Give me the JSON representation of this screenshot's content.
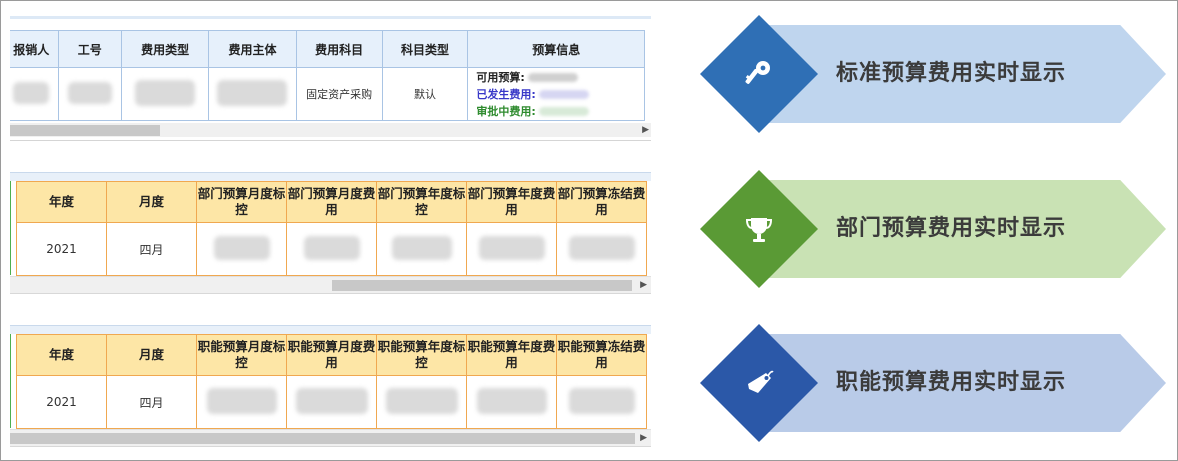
{
  "panel1": {
    "headers": [
      "报销人",
      "工号",
      "费用类型",
      "费用主体",
      "费用科目",
      "科目类型",
      "预算信息"
    ],
    "row": {
      "subject": "固定资产采购",
      "subject_type": "默认"
    },
    "budget": {
      "available": "可用预算:",
      "spent": "已发生费用:",
      "pending": "审批中费用:"
    }
  },
  "panel2": {
    "headers": [
      "年度",
      "月度",
      "部门预算月度标控",
      "部门预算月度费用",
      "部门预算年度标控",
      "部门预算年度费用",
      "部门预算冻结费用"
    ],
    "row": {
      "year": "2021",
      "month": "四月"
    }
  },
  "panel3": {
    "headers": [
      "年度",
      "月度",
      "职能预算月度标控",
      "职能预算月度费用",
      "职能预算年度标控",
      "职能预算年度费用",
      "职能预算冻结费用"
    ],
    "row": {
      "year": "2021",
      "month": "四月"
    }
  },
  "banners": [
    {
      "label": "标准预算费用实时显示",
      "icon": "key-icon",
      "diamond_color": "#2f6fb5",
      "arrow_color": "#bfd5ee"
    },
    {
      "label": "部门预算费用实时显示",
      "icon": "trophy-icon",
      "diamond_color": "#5a9a35",
      "arrow_color": "#c9e2b4"
    },
    {
      "label": "职能预算费用实时显示",
      "icon": "tag-icon",
      "diamond_color": "#2b58a8",
      "arrow_color": "#b9cbe8"
    }
  ]
}
